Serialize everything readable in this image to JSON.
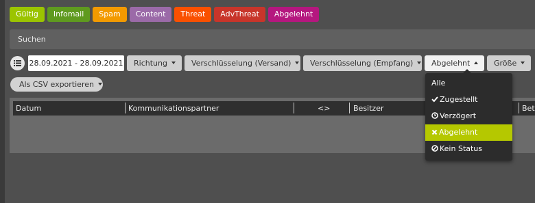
{
  "tags": [
    {
      "label": "Gültig",
      "color": "#9bc400"
    },
    {
      "label": "Infomail",
      "color": "#5f9a1f"
    },
    {
      "label": "Spam",
      "color": "#f39a00"
    },
    {
      "label": "Content",
      "color": "#9b6aa8"
    },
    {
      "label": "Threat",
      "color": "#fa5000"
    },
    {
      "label": "AdvThreat",
      "color": "#c8352a"
    },
    {
      "label": "Abgelehnt",
      "color": "#b5177f"
    }
  ],
  "search": {
    "placeholder": "Suchen"
  },
  "filters": {
    "date_range": "28.09.2021 - 28.09.2021",
    "richtung": "Richtung",
    "enc_send": "Verschlüsselung (Versand)",
    "enc_recv": "Verschlüsselung (Empfang)",
    "status": "Abgelehnt",
    "size": "Größe"
  },
  "export": {
    "label": "Als CSV exportieren"
  },
  "table": {
    "headers": [
      "Datum",
      "Kommunikationspartner",
      "<>",
      "Besitzer",
      "Betr"
    ]
  },
  "status_menu": {
    "items": [
      {
        "label": "Alle",
        "icon": "none",
        "selected": false
      },
      {
        "label": "Zugestellt",
        "icon": "check-icon",
        "selected": false
      },
      {
        "label": "Verzögert",
        "icon": "clock-icon",
        "selected": false
      },
      {
        "label": "Abgelehnt",
        "icon": "x-icon",
        "selected": true
      },
      {
        "label": "Kein Status",
        "icon": "ban-icon",
        "selected": false
      }
    ]
  }
}
